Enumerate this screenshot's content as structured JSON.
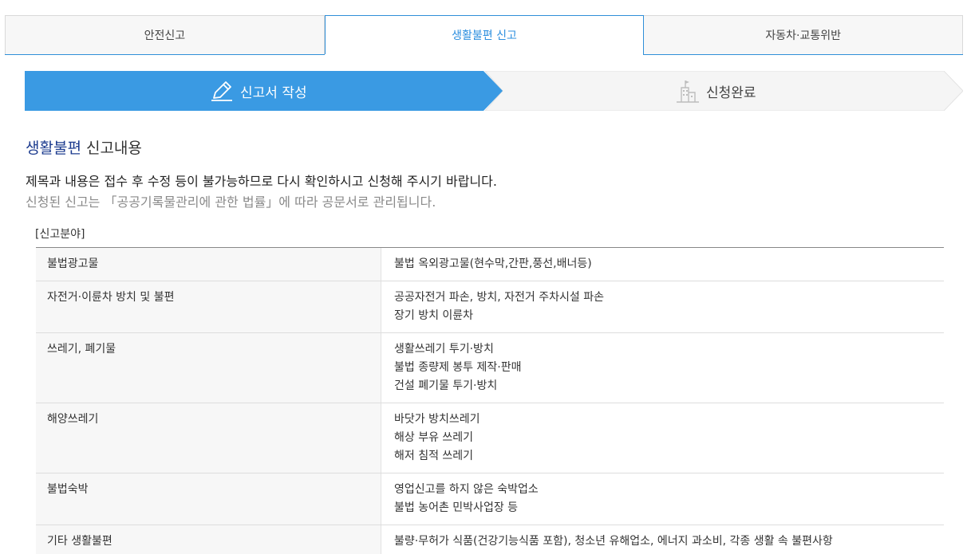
{
  "tabs": [
    {
      "label": "안전신고",
      "active": false
    },
    {
      "label": "생활불편 신고",
      "active": true
    },
    {
      "label": "자동차·교통위반",
      "active": false
    }
  ],
  "steps": {
    "step1_label": "신고서 작성",
    "step2_label": "신청완료"
  },
  "section": {
    "title_accent": "생활불편",
    "title_rest": " 신고내용",
    "notice_primary": "제목과 내용은 접수 후 수정 등이 불가능하므로 다시 확인하시고 신청해 주시기 바랍니다.",
    "notice_secondary": "신청된 신고는 「공공기록물관리에 관한 법률」에 따라 공문서로 관리됩니다.",
    "field_label": "[신고분야]"
  },
  "categories": [
    {
      "name": "불법광고물",
      "items": [
        "불법 옥외광고물(현수막,간판,풍선,배너등)"
      ]
    },
    {
      "name": "자전거·이륜차 방치 및 불편",
      "items": [
        "공공자전거 파손, 방치, 자전거 주차시설 파손",
        "장기 방치 이륜차"
      ]
    },
    {
      "name": "쓰레기, 폐기물",
      "items": [
        "생활쓰레기 투기·방치",
        "불법 종량제 봉투 제작·판매",
        "건설 폐기물 투기·방치"
      ]
    },
    {
      "name": "해양쓰레기",
      "items": [
        "바닷가 방치쓰레기",
        "해상 부유 쓰레기",
        "해저 침적 쓰레기"
      ]
    },
    {
      "name": "불법숙박",
      "items": [
        "영업신고를 하지 않은 숙박업소",
        "불법 농어촌 민박사업장 등"
      ]
    },
    {
      "name": "기타 생활불편",
      "items": [
        "불량·무허가 식품(건강기능식품 포함), 청소년 유해업소, 에너지 과소비, 각종 생활 속 불편사항"
      ]
    }
  ],
  "colors": {
    "accent_blue": "#3a9ae3",
    "tab_active_text": "#2d8fdf",
    "title_accent": "#1d3c8f"
  },
  "icons": {
    "step1": "pencil-icon",
    "step2": "building-flag-icon"
  }
}
